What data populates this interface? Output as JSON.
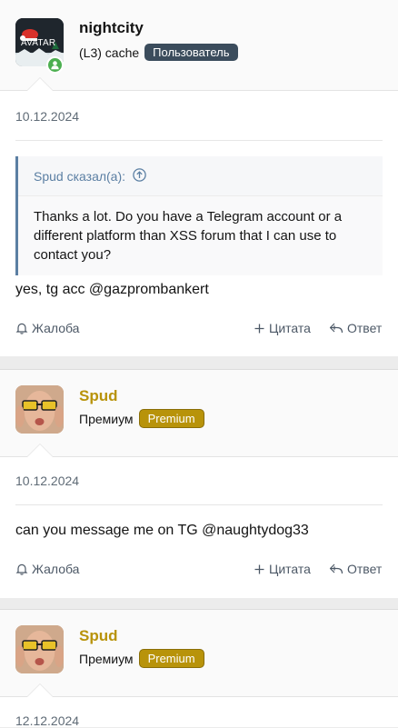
{
  "posts": [
    {
      "username": "nightcity",
      "user_title": "(L3) cache",
      "badge": "Пользователь",
      "avatar_text": "AVATAR",
      "date": "10.12.2024",
      "quote": {
        "author": "Spud сказал(а):",
        "text": "Thanks a lot. Do you have a Telegram account or a different platform than XSS forum that I can use to contact you?"
      },
      "message": "yes, tg acc @gazprombankert"
    },
    {
      "username": "Spud",
      "user_title": "Премиум",
      "badge": "Premium",
      "date": "10.12.2024",
      "message": "can you message me on TG @naughtydog33"
    },
    {
      "username": "Spud",
      "user_title": "Премиум",
      "badge": "Premium",
      "date": "12.12.2024"
    }
  ],
  "actions": {
    "report": "Жалоба",
    "quote": "Цитата",
    "reply": "Ответ"
  },
  "colors": {
    "premium_name": "#b8930a",
    "user_badge": "#3b4c5c",
    "quote_accent": "#5b7fa3",
    "online": "#4caf50"
  }
}
